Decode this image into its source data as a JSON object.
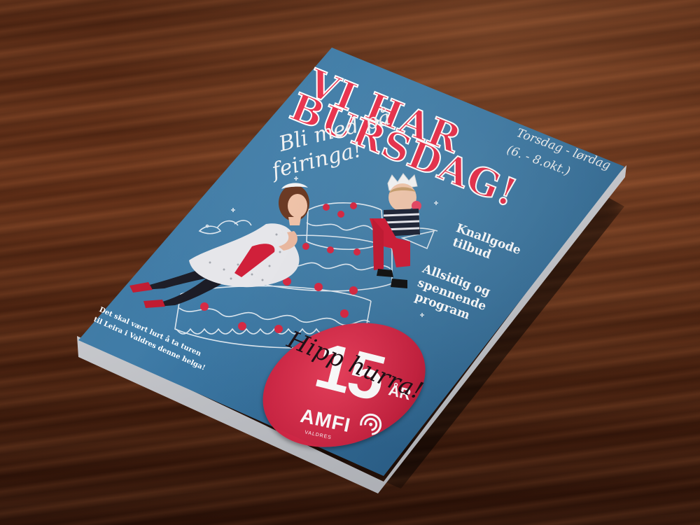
{
  "scene": {
    "surface": "dark wooden table",
    "object": "folded event brochure"
  },
  "colors": {
    "cover_blue": "#3d7aa6",
    "headline_red": "#e8354f",
    "badge_red": "#d92b48",
    "text_white": "#ffffff",
    "script_dark": "#1e1016"
  },
  "cover": {
    "headline_line1": "VI HAR",
    "headline_line2": "BURSDAG!",
    "subhead_line1": "Bli med på",
    "subhead_line2": "feiringa!",
    "dates_line1": "Torsdag - lørdag",
    "dates_line2": "(6. - 8.okt.)",
    "bullet1_line1": "Knallgode",
    "bullet1_line2": "tilbud",
    "bullet2_line1": "Allsidig og",
    "bullet2_line2": "spennende",
    "bullet2_line3": "program",
    "footer_line1": "Det skal vært lurt å ta turen",
    "footer_line2": "til Leira i Valdres denne helga!"
  },
  "badge": {
    "number": "15",
    "unit": "ÅR",
    "script": "Hipp hurra!",
    "brand": "AMFI",
    "brand_sub": "VALDRES",
    "logo_icon": "amfi-swirl-icon"
  },
  "photo_subjects": [
    "woman-in-dress",
    "child-with-crown",
    "illustrated-cake"
  ]
}
